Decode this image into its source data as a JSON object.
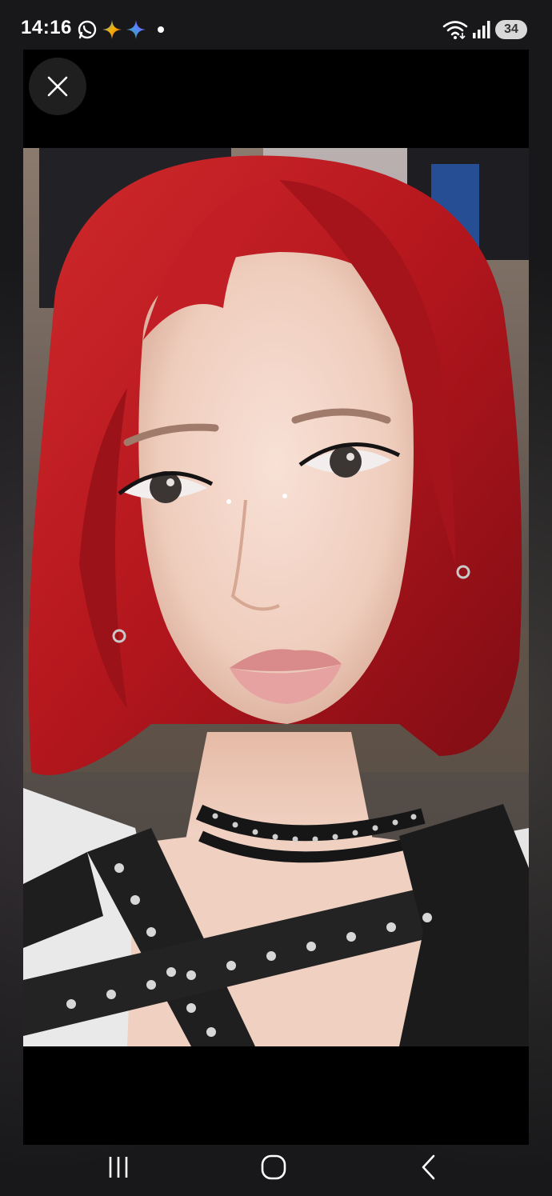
{
  "status_bar": {
    "time": "14:16",
    "battery_level": "34",
    "icons": [
      "whatsapp-icon",
      "sparkle-icon",
      "sparkle-icon",
      "notification-dot",
      "wifi-icon",
      "signal-icon",
      "battery-icon"
    ]
  },
  "viewer": {
    "close_icon": "close-icon",
    "photo_subject": "portrait-photo"
  },
  "navigation": {
    "icons": [
      "recent-apps-icon",
      "home-icon",
      "back-icon"
    ]
  },
  "colors": {
    "background": "#000000",
    "hair": "#b8161e",
    "skin": "#f2d3c6",
    "jacket": "#1e1e1e"
  }
}
